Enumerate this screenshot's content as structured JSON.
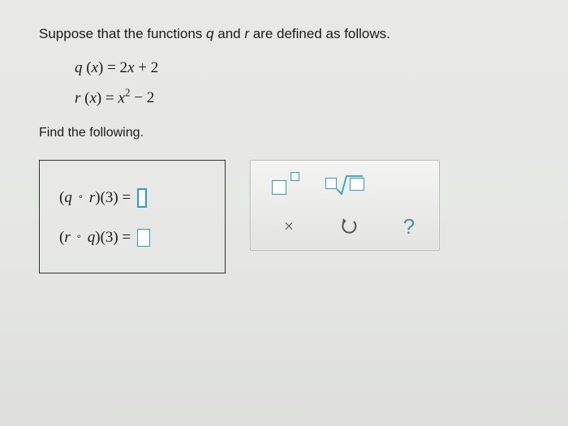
{
  "intro": "Suppose that the functions q and r are defined as follows.",
  "defs": {
    "q": "q (x) = 2x + 2",
    "r": "r (x) = x² − 2"
  },
  "find": "Find the following.",
  "answers": {
    "line1_lhs": "(q ∘ r)(3) =",
    "line2_lhs": "(r ∘ q)(3) ="
  },
  "tools": {
    "exponent": "exponent",
    "root": "nth-root",
    "clear": "×",
    "reset": "↺",
    "help": "?"
  }
}
